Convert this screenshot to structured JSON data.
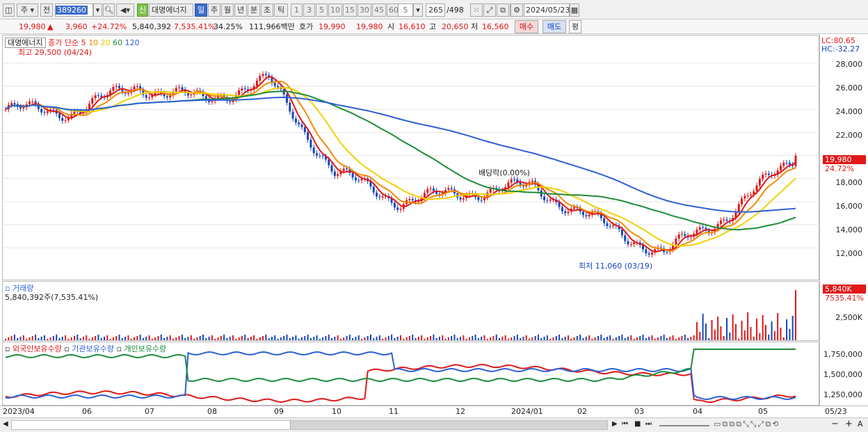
{
  "toolbar": {
    "market": "주",
    "type": "전",
    "code": "389260",
    "badge": "신",
    "name": "대명에너지",
    "periods": [
      "일",
      "주",
      "월",
      "년",
      "분",
      "초",
      "틱"
    ],
    "active_period": "일",
    "intervals": [
      "1",
      "3",
      "5",
      "10",
      "15",
      "30",
      "45",
      "60"
    ],
    "interval_value": "5",
    "count": "265",
    "count_total": "/498",
    "date": "2024/05/23"
  },
  "info": {
    "price": "19,980",
    "change_arrow": "▲",
    "change": "3,960",
    "change_pct": "+24.72%",
    "volume": "5,840,392",
    "volume_ratio": "7,535.41%",
    "turnover": "34.25%",
    "amount": "111,966백만",
    "quote_label": "호가",
    "ask": "19,990",
    "bid": "19,980",
    "open_label": "시",
    "open": "16,610",
    "high_label": "고",
    "high": "20,650",
    "low_label": "저",
    "low": "16,560",
    "buy": "매수",
    "sell": "매도",
    "eval": "평"
  },
  "price_pane": {
    "stock_label": "대명에너지",
    "ma_label": "종가 단순",
    "ma_periods": [
      "5",
      "10",
      "20",
      "60",
      "120"
    ],
    "ma_colors": [
      "#e01818",
      "#f08c00",
      "#f0d000",
      "#1e8c3a",
      "#2d5fd4"
    ],
    "high_note": "최고 29,500 (04/24)",
    "low_note": "최저 11,060 (03/19)",
    "dividend_note": "배당락(0.00%)",
    "lc": "LC:80.65",
    "hc": "HC:-32.27",
    "y_labels": [
      "28,000",
      "26,000",
      "24,000",
      "22,000",
      "20,000",
      "18,000",
      "16,000",
      "14,000",
      "12,000"
    ],
    "current_price": "19,980",
    "current_pct": "24.72%"
  },
  "volume_pane": {
    "title": "거래량",
    "value": "5,840,392주(7,535.41%)",
    "tag_value": "5,840K",
    "tag_pct": "7535.41%",
    "y_label": "2,500K"
  },
  "holding_pane": {
    "legend": [
      "외국인보유수량",
      "기관보유수량",
      "개인보유수량"
    ],
    "colors": [
      "#e01818",
      "#2d5fd4",
      "#1e8c3a"
    ],
    "y_labels": [
      "1,750,000",
      "1,500,000",
      "1,250,000"
    ]
  },
  "x_axis": {
    "labels": [
      "2023/04",
      "06",
      "07",
      "08",
      "09",
      "10",
      "11",
      "12",
      "2024/01",
      "02",
      "03",
      "04",
      "05"
    ],
    "last_label": "05/23"
  },
  "chart_data": {
    "type": "candlestick",
    "y_range": [
      10500,
      29200
    ],
    "monthly_closes": [
      {
        "month": "2023/04",
        "price": 24000
      },
      {
        "month": "06",
        "price": 23800
      },
      {
        "month": "07",
        "price": 26000
      },
      {
        "month": "08",
        "price": 24800
      },
      {
        "month": "09",
        "price": 26500
      },
      {
        "month": "10",
        "price": 18500
      },
      {
        "month": "11",
        "price": 16000
      },
      {
        "month": "12",
        "price": 16800
      },
      {
        "month": "2024/01",
        "price": 17300
      },
      {
        "month": "02",
        "price": 14200
      },
      {
        "month": "03",
        "price": 11500
      },
      {
        "month": "04",
        "price": 15000
      },
      {
        "month": "05",
        "price": 19980
      }
    ]
  }
}
